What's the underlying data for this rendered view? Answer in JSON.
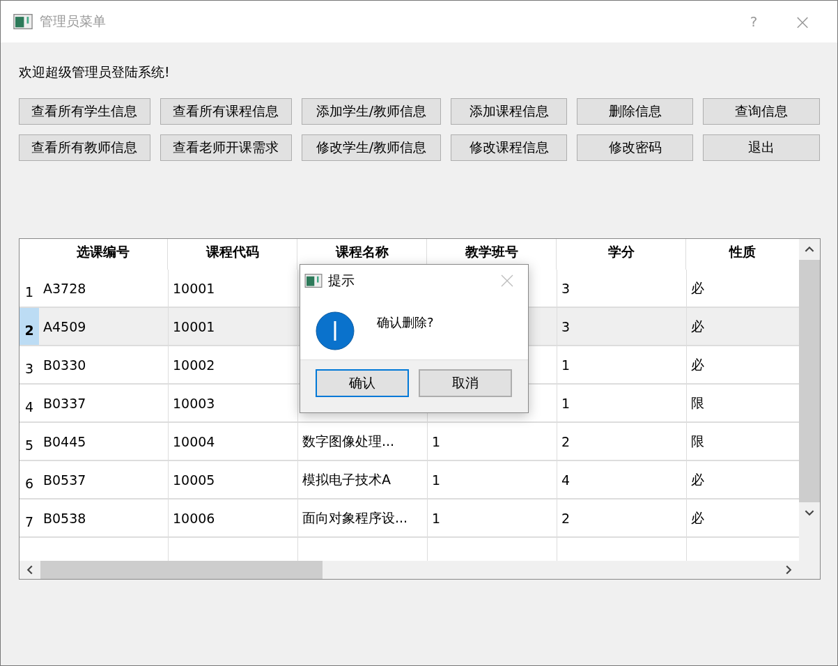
{
  "window": {
    "title": "管理员菜单",
    "help": "?",
    "close": "×"
  },
  "welcome": "欢迎超级管理员登陆系统!",
  "buttons": [
    [
      "查看所有学生信息",
      "查看所有课程信息",
      "添加学生/教师信息",
      "添加课程信息",
      "删除信息",
      "查询信息"
    ],
    [
      "查看所有教师信息",
      "查看老师开课需求",
      "修改学生/教师信息",
      "修改课程信息",
      "修改密码",
      "退出"
    ]
  ],
  "table": {
    "columns": [
      "选课编号",
      "课程代码",
      "课程名称",
      "教学班号",
      "学分",
      "性质"
    ],
    "rows": [
      {
        "number": "1",
        "selected": false,
        "cells": [
          "A3728",
          "10001",
          null,
          null,
          "3",
          "必"
        ]
      },
      {
        "number": "2",
        "selected": true,
        "cells": [
          "A4509",
          "10001",
          null,
          null,
          "3",
          "必"
        ]
      },
      {
        "number": "3",
        "selected": false,
        "cells": [
          "B0330",
          "10002",
          null,
          null,
          "1",
          "必"
        ]
      },
      {
        "number": "4",
        "selected": false,
        "cells": [
          "B0337",
          "10003",
          null,
          null,
          "1",
          "限"
        ]
      },
      {
        "number": "5",
        "selected": false,
        "cells": [
          "B0445",
          "10004",
          "数字图像处理...",
          "1",
          "2",
          "限"
        ]
      },
      {
        "number": "6",
        "selected": false,
        "cells": [
          "B0537",
          "10005",
          "模拟电子技术A",
          "1",
          "4",
          "必"
        ]
      },
      {
        "number": "7",
        "selected": false,
        "cells": [
          "B0538",
          "10006",
          "面向对象程序设...",
          "1",
          "2",
          "必"
        ]
      }
    ]
  },
  "dialog": {
    "title": "提示",
    "message": "确认删除?",
    "buttons": [
      {
        "label": "确认",
        "selected": true
      },
      {
        "label": "取消",
        "selected": false
      }
    ]
  }
}
